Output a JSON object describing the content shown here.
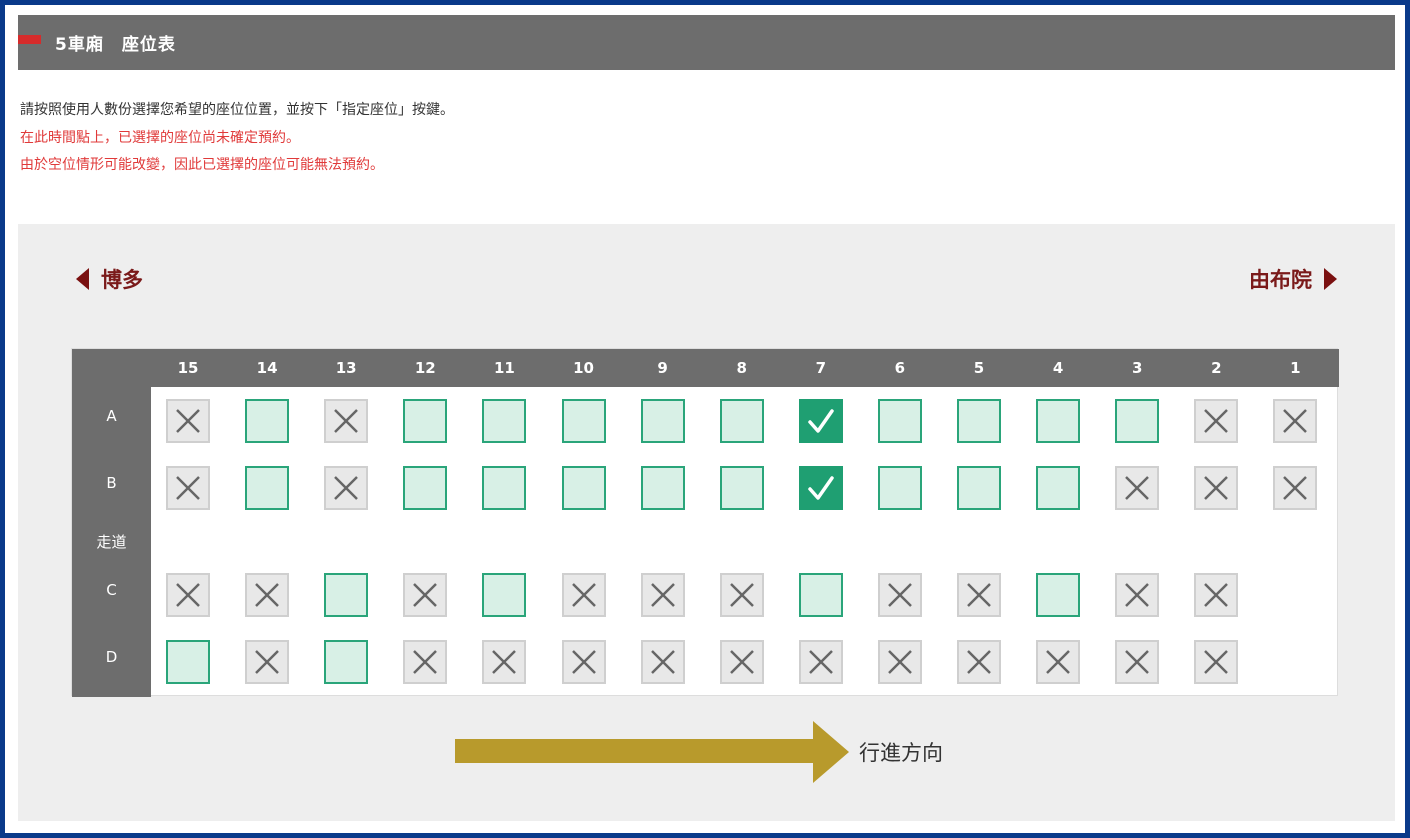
{
  "header": {
    "title": "5車廂　座位表"
  },
  "notes": {
    "instruction": "請按照使用人數份選擇您希望的座位位置，並按下「指定座位」按鍵。",
    "warning1": "在此時間點上，已選擇的座位尚未確定預約。",
    "warning2": "由於空位情形可能改變，因此已選擇的座位可能無法預約。"
  },
  "directions": {
    "left": "博多",
    "right": "由布院"
  },
  "colors": {
    "available": "#2aa57a",
    "selected": "#1f9f72",
    "header_bg": "#6d6d6d",
    "direction": "#7a1010",
    "arrow": "#b89a2c",
    "warning": "#e03a3a"
  },
  "seatmap": {
    "columns": [
      "15",
      "14",
      "13",
      "12",
      "11",
      "10",
      "9",
      "8",
      "7",
      "6",
      "5",
      "4",
      "3",
      "2",
      "1"
    ],
    "aisle_label": "走道",
    "rows": [
      {
        "label": "A",
        "seats": [
          "taken",
          "avail",
          "taken",
          "avail",
          "avail",
          "avail",
          "avail",
          "avail",
          "selected",
          "avail",
          "avail",
          "avail",
          "avail",
          "taken",
          "taken"
        ]
      },
      {
        "label": "B",
        "seats": [
          "taken",
          "avail",
          "taken",
          "avail",
          "avail",
          "avail",
          "avail",
          "avail",
          "selected",
          "avail",
          "avail",
          "avail",
          "taken",
          "taken",
          "taken"
        ]
      },
      {
        "label": "C",
        "seats": [
          "taken",
          "taken",
          "avail",
          "taken",
          "avail",
          "taken",
          "taken",
          "taken",
          "avail",
          "taken",
          "taken",
          "avail",
          "taken",
          "taken",
          ""
        ]
      },
      {
        "label": "D",
        "seats": [
          "avail",
          "taken",
          "avail",
          "taken",
          "taken",
          "taken",
          "taken",
          "taken",
          "taken",
          "taken",
          "taken",
          "taken",
          "taken",
          "taken",
          ""
        ]
      }
    ]
  },
  "travel": {
    "label": "行進方向"
  }
}
